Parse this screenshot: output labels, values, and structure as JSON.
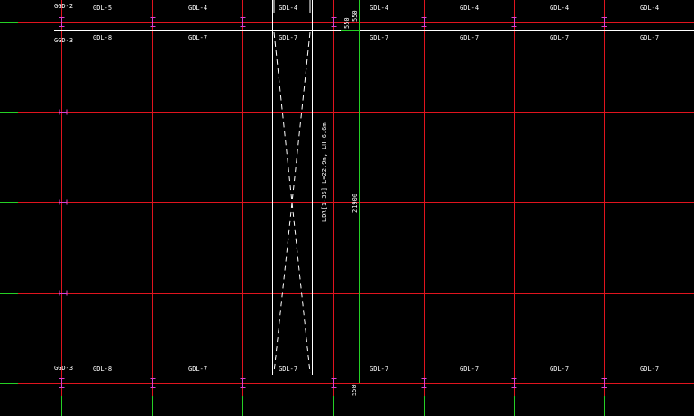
{
  "drawing": {
    "grid_tags": {
      "top_left": "GGD-2",
      "upper_left": "GGD-3",
      "bottom_left": "GGD-3"
    },
    "top_row_labels": [
      "GDL-5",
      "GDL-4",
      "GDL-4",
      "GDL-4",
      "GDL-4",
      "GDL-4",
      "GDL-4"
    ],
    "upper_row_labels": [
      "GDL-8",
      "GDL-7",
      "GDL-7",
      "GDL-7",
      "GDL-7",
      "GDL-7",
      "GDL-7"
    ],
    "bottom_row_labels": [
      "GDL-8",
      "GDL-7",
      "GDL-7",
      "GDL-7",
      "GDL-7",
      "GDL-7",
      "GDL-7"
    ],
    "dimensions": {
      "top_a": "550",
      "top_b": "550",
      "total": "21900",
      "bottom": "550"
    },
    "beam_note": "LDR[1-36] L=22.9m, LH-6.6m",
    "colors": {
      "background": "#000000",
      "grid_red": "#e0141e",
      "axis_green": "#25d025",
      "tick_magenta": "#e040d0",
      "line_white": "#ffffff"
    }
  }
}
